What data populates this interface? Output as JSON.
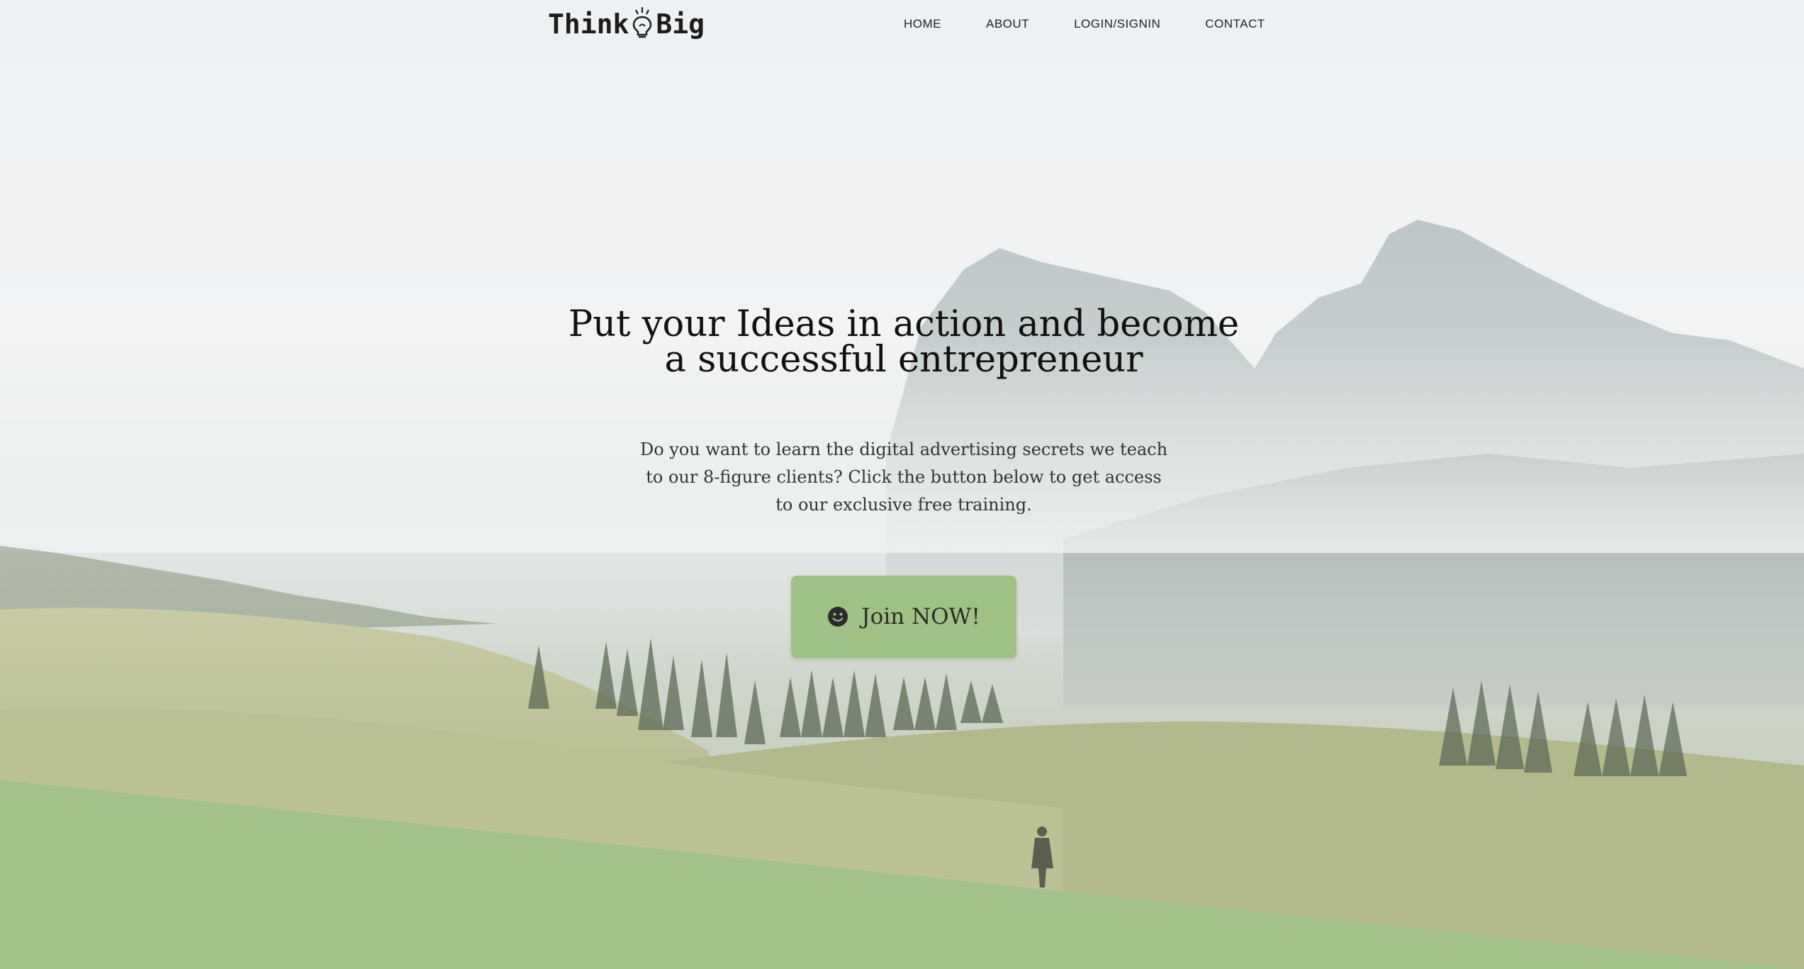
{
  "brand": {
    "logo_left": "Think",
    "logo_right": "Big"
  },
  "nav": {
    "items": [
      {
        "label": "HOME"
      },
      {
        "label": "ABOUT"
      },
      {
        "label": "LOGIN/SIGNIN"
      },
      {
        "label": "CONTACT"
      }
    ]
  },
  "hero": {
    "title_line1": "Put your Ideas in action and become",
    "title_line2": "a successful entrepreneur",
    "subtitle_line1": "Do you want to learn the digital advertising secrets we teach",
    "subtitle_line2": "to our 8-figure clients? Click the button below to get access",
    "subtitle_line3": "to our exclusive free training.",
    "cta_label": "Join NOW!",
    "cta_icon": "smiley-icon"
  },
  "colors": {
    "accent_green": "#a3c289",
    "button_green": "#9fc185",
    "text_dark": "#111111"
  }
}
